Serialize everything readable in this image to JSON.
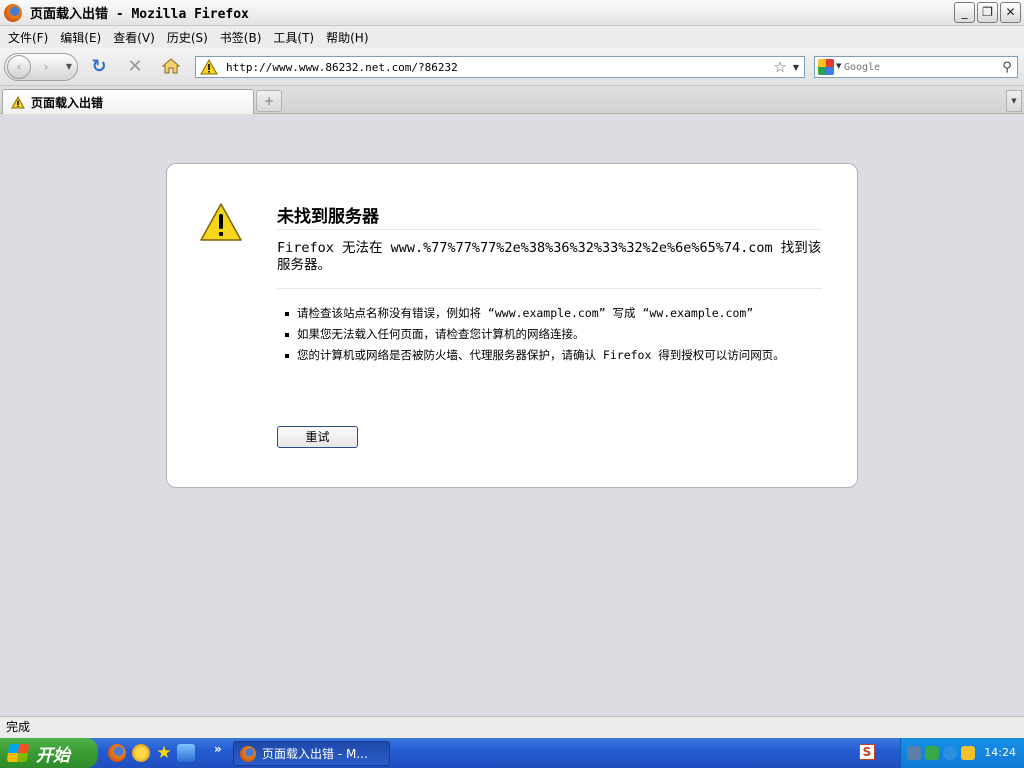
{
  "window": {
    "title": "页面载入出错 - Mozilla Firefox",
    "minimize": "_",
    "restore": "❐",
    "close": "✕"
  },
  "menu": [
    "文件(F)",
    "编辑(E)",
    "查看(V)",
    "历史(S)",
    "书签(B)",
    "工具(T)",
    "帮助(H)"
  ],
  "nav": {
    "url": "http://www.www.86232.net.com/?86232",
    "search_placeholder": "Google"
  },
  "tabs": [
    {
      "label": "页面载入出错"
    }
  ],
  "error": {
    "title": "未找到服务器",
    "description": "Firefox 无法在 www.%77%77%77%2e%38%36%32%33%32%2e%6e%65%74.com 找到该服务器。",
    "bullets": [
      "请检查该站点名称没有错误，例如将 “www.example.com” 写成 “ww.example.com”",
      "如果您无法载入任何页面，请检查您计算机的网络连接。",
      "您的计算机或网络是否被防火墙、代理服务器保护，请确认 Firefox 得到授权可以访问网页。"
    ],
    "retry_label": "重试"
  },
  "status": "完成",
  "taskbar": {
    "start_label": "开始",
    "task_label": "页面载入出错 - M...",
    "clock": "14:24"
  }
}
